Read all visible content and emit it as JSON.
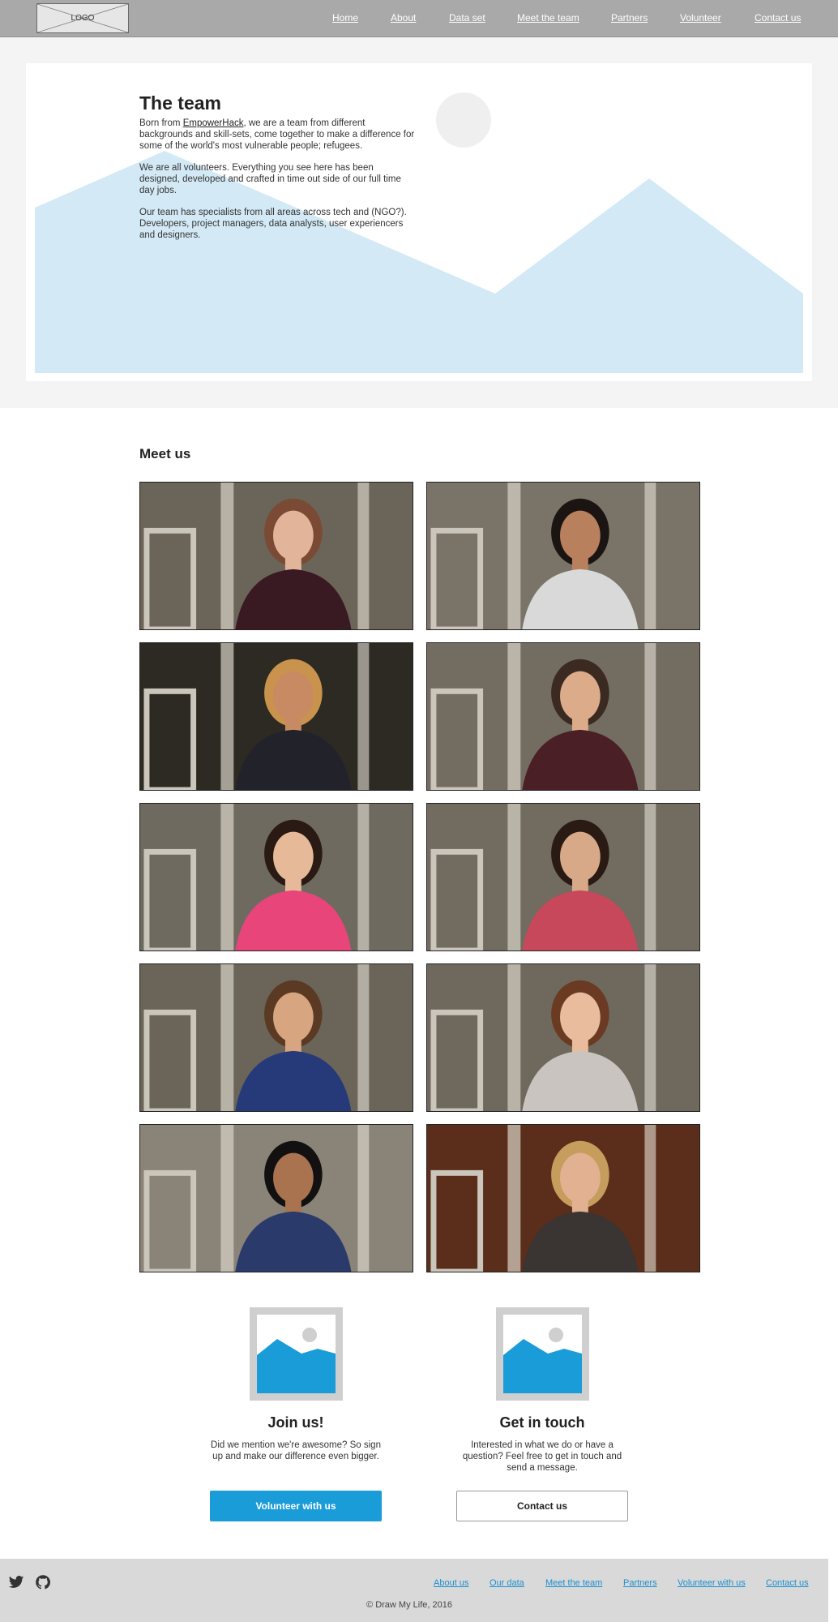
{
  "header": {
    "logo_text": "LOGO",
    "nav": [
      "Home",
      "About",
      "Data set",
      "Meet the team",
      "Partners",
      "Volunteer",
      "Contact us"
    ]
  },
  "hero": {
    "title": "The team",
    "p1_prefix": "Born from ",
    "p1_link": "EmpowerHack",
    "p1_suffix": ", we are a team from different backgrounds and skill-sets, come together to make a difference for some of the world's most vulnerable people; refugees.",
    "p2": "We are all volunteers. Everything you see here has been designed, developed and crafted in time out side of our full time day jobs.",
    "p3": "Our team has specialists from all areas across tech and (NGO?). Developers, project managers, data analysts, user experiencers and designers."
  },
  "meet": {
    "title": "Meet us",
    "photo_count": 10
  },
  "ctas": [
    {
      "title": "Join us!",
      "text": "Did we mention we're awesome? So sign up and make our difference even bigger.",
      "button": "Volunteer with us"
    },
    {
      "title": "Get in touch",
      "text": "Interested in what we do or have a question? Feel free to get in touch and send a message.",
      "button": "Contact us"
    }
  ],
  "footer": {
    "social_icons": [
      "twitter-icon",
      "github-icon"
    ],
    "links": [
      "About us",
      "Our data",
      "Meet the team",
      "Partners",
      "Volunteer with us",
      "Contact us"
    ],
    "copyright": "Draw My Life, 2016"
  },
  "colors": {
    "header_bg": "#a9a9a9",
    "mountain": "#d3eaf6",
    "primary_button": "#1a9cd8",
    "footer_bg": "#d9d9d9",
    "footer_link": "#1a8fd0"
  }
}
